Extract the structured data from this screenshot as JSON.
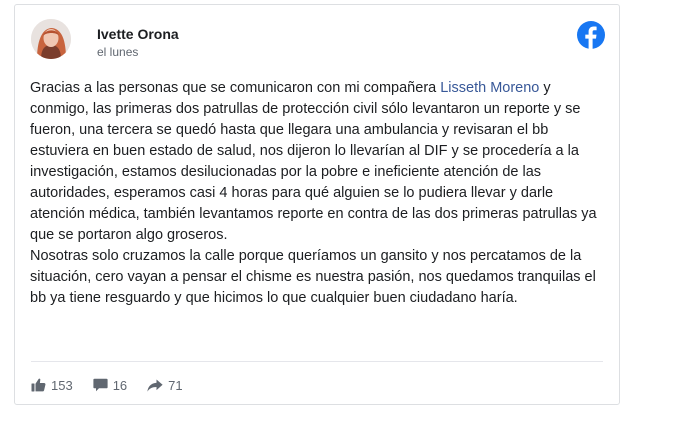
{
  "post": {
    "author": "Ivette Orona",
    "date": "el lunes",
    "body_p1_before_mention": "Gracias a las personas que se comunicaron con mi compañera ",
    "mention": "Lisseth Moreno",
    "body_p1_after_mention": " y conmigo, las primeras dos patrullas de protección civil sólo levantaron un reporte y se fueron, una tercera se quedó hasta que llegara una ambulancia y revisaran el bb estuviera en buen estado de salud, nos dijeron lo llevarían al DIF y se procedería a la investigación, estamos desilucionadas por la pobre e ineficiente atención de las autoridades, esperamos casi 4 horas para qué alguien se lo pudiera llevar y darle atención médica, también levantamos reporte en contra de las dos primeras patrullas ya que se portaron algo groseros.",
    "body_p2": "Nosotras solo cruzamos la calle porque queríamos un gansito y nos percatamos de la situación, cero vayan a pensar el chisme es nuestra pasión, nos quedamos tranquilas el bb ya tiene resguardo y que hicimos lo que cualquier buen ciudadano haría."
  },
  "stats": {
    "likes": "153",
    "comments": "16",
    "shares": "71"
  },
  "icons": {
    "logo": "facebook-logo-icon",
    "like": "thumbs-up-icon",
    "comment": "comment-bubble-icon",
    "share": "share-arrow-icon"
  },
  "colors": {
    "facebook_blue": "#1877f2",
    "mention_link": "#385898",
    "text_primary": "#1c1e21",
    "text_secondary": "#606770"
  }
}
